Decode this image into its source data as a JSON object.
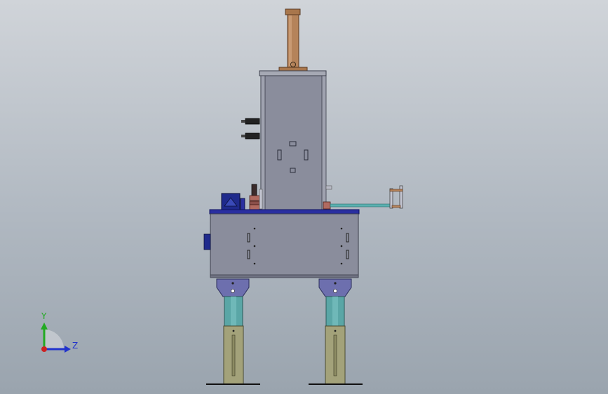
{
  "viewport": {
    "background_top": "#d0d4d9",
    "background_bottom": "#9aa4ae"
  },
  "triad": {
    "y_label": "Y",
    "z_label": "Z",
    "y_color": "#22aa22",
    "z_color": "#2233cc",
    "origin_color": "#cc2222"
  },
  "model": {
    "body_color": "#8a8d9c",
    "edge_color": "#3a3d4a",
    "plate_color": "#2a2fa0",
    "leg_bracket_color": "#6d6fae",
    "leg_upper_color": "#5aa6a6",
    "leg_lower_color": "#a3a27a",
    "chimney_color": "#b5835a"
  }
}
